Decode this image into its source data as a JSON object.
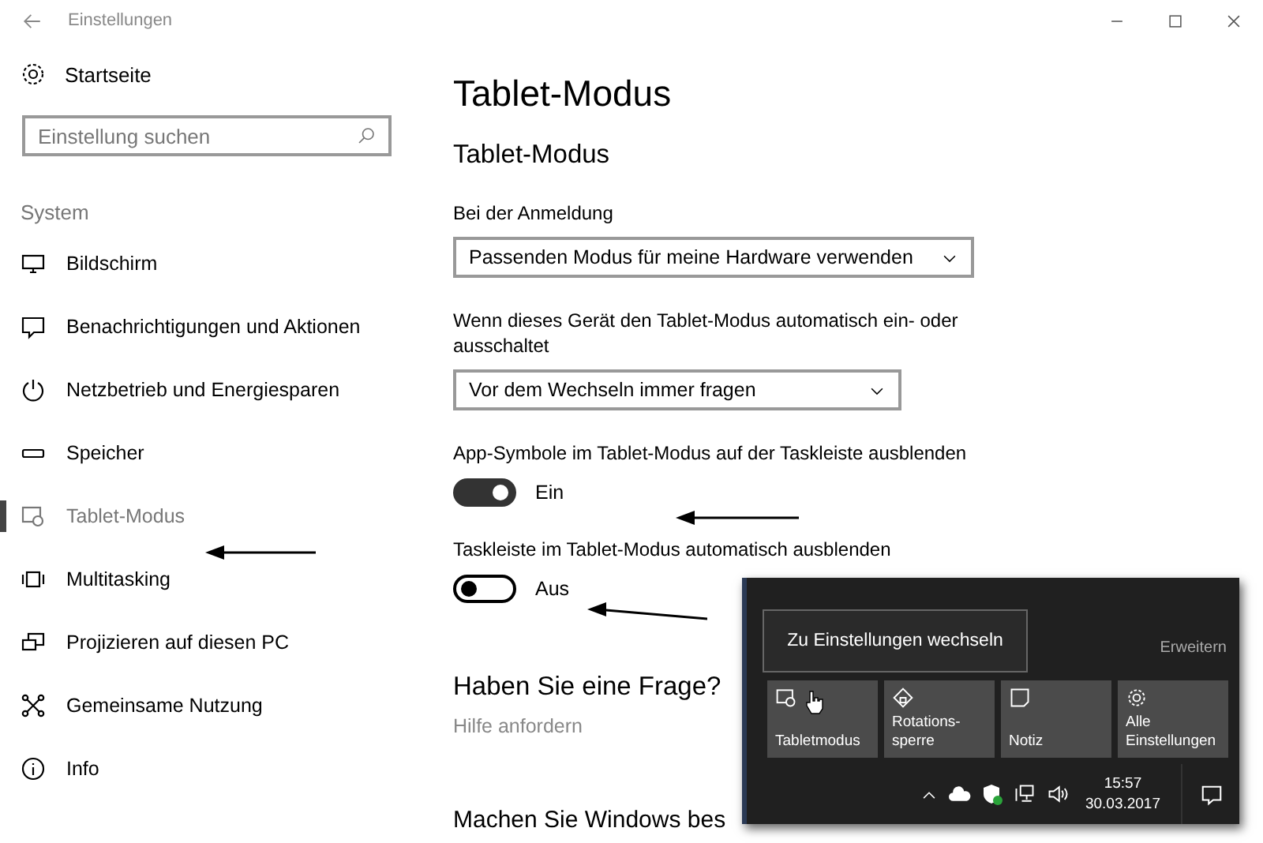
{
  "window": {
    "title": "Einstellungen"
  },
  "sidebar": {
    "home": "Startseite",
    "search": {
      "placeholder": "Einstellung suchen"
    },
    "section": "System",
    "items": [
      {
        "label": "Bildschirm",
        "kind": "display",
        "selected": false
      },
      {
        "label": "Benachrichtigungen und Aktionen",
        "kind": "notification",
        "selected": false
      },
      {
        "label": "Netzbetrieb und Energiesparen",
        "kind": "power",
        "selected": false
      },
      {
        "label": "Speicher",
        "kind": "storage",
        "selected": false
      },
      {
        "label": "Tablet-Modus",
        "kind": "tablet",
        "selected": true
      },
      {
        "label": "Multitasking",
        "kind": "multitasking",
        "selected": false
      },
      {
        "label": "Projizieren auf diesen PC",
        "kind": "project",
        "selected": false
      },
      {
        "label": "Gemeinsame Nutzung",
        "kind": "share",
        "selected": false
      },
      {
        "label": "Info",
        "kind": "info",
        "selected": false
      }
    ]
  },
  "main": {
    "title": "Tablet-Modus",
    "subtitle": "Tablet-Modus",
    "settings": [
      {
        "kind": "dropdown",
        "label": "Bei der Anmeldung",
        "value": "Passenden Modus für meine Hardware verwenden"
      },
      {
        "kind": "dropdown",
        "label": "Wenn dieses Gerät den Tablet-Modus automatisch ein- oder ausschaltet",
        "value": "Vor dem Wechseln immer fragen"
      },
      {
        "kind": "toggle",
        "label": "App-Symbole im Tablet-Modus auf der Taskleiste ausblenden",
        "on": true,
        "state_text": "Ein"
      },
      {
        "kind": "toggle",
        "label": "Taskleiste im Tablet-Modus automatisch ausblenden",
        "on": false,
        "state_text": "Aus"
      }
    ],
    "help": {
      "heading": "Haben Sie eine Frage?",
      "link": "Hilfe anfordern"
    },
    "next_heading": "Machen Sie Windows bes"
  },
  "action_center": {
    "tooltip": "Zu Einstellungen wechseln",
    "expand": "Erweitern",
    "tiles": [
      {
        "label": "Tabletmodus",
        "kind": "tablet"
      },
      {
        "label": "Rotations-\nsperre",
        "kind": "rotation"
      },
      {
        "label": "Notiz",
        "kind": "note"
      },
      {
        "label": "Alle\nEinstellungen",
        "kind": "settings"
      }
    ],
    "tray": {
      "time": "15:57",
      "date": "30.03.2017"
    }
  }
}
